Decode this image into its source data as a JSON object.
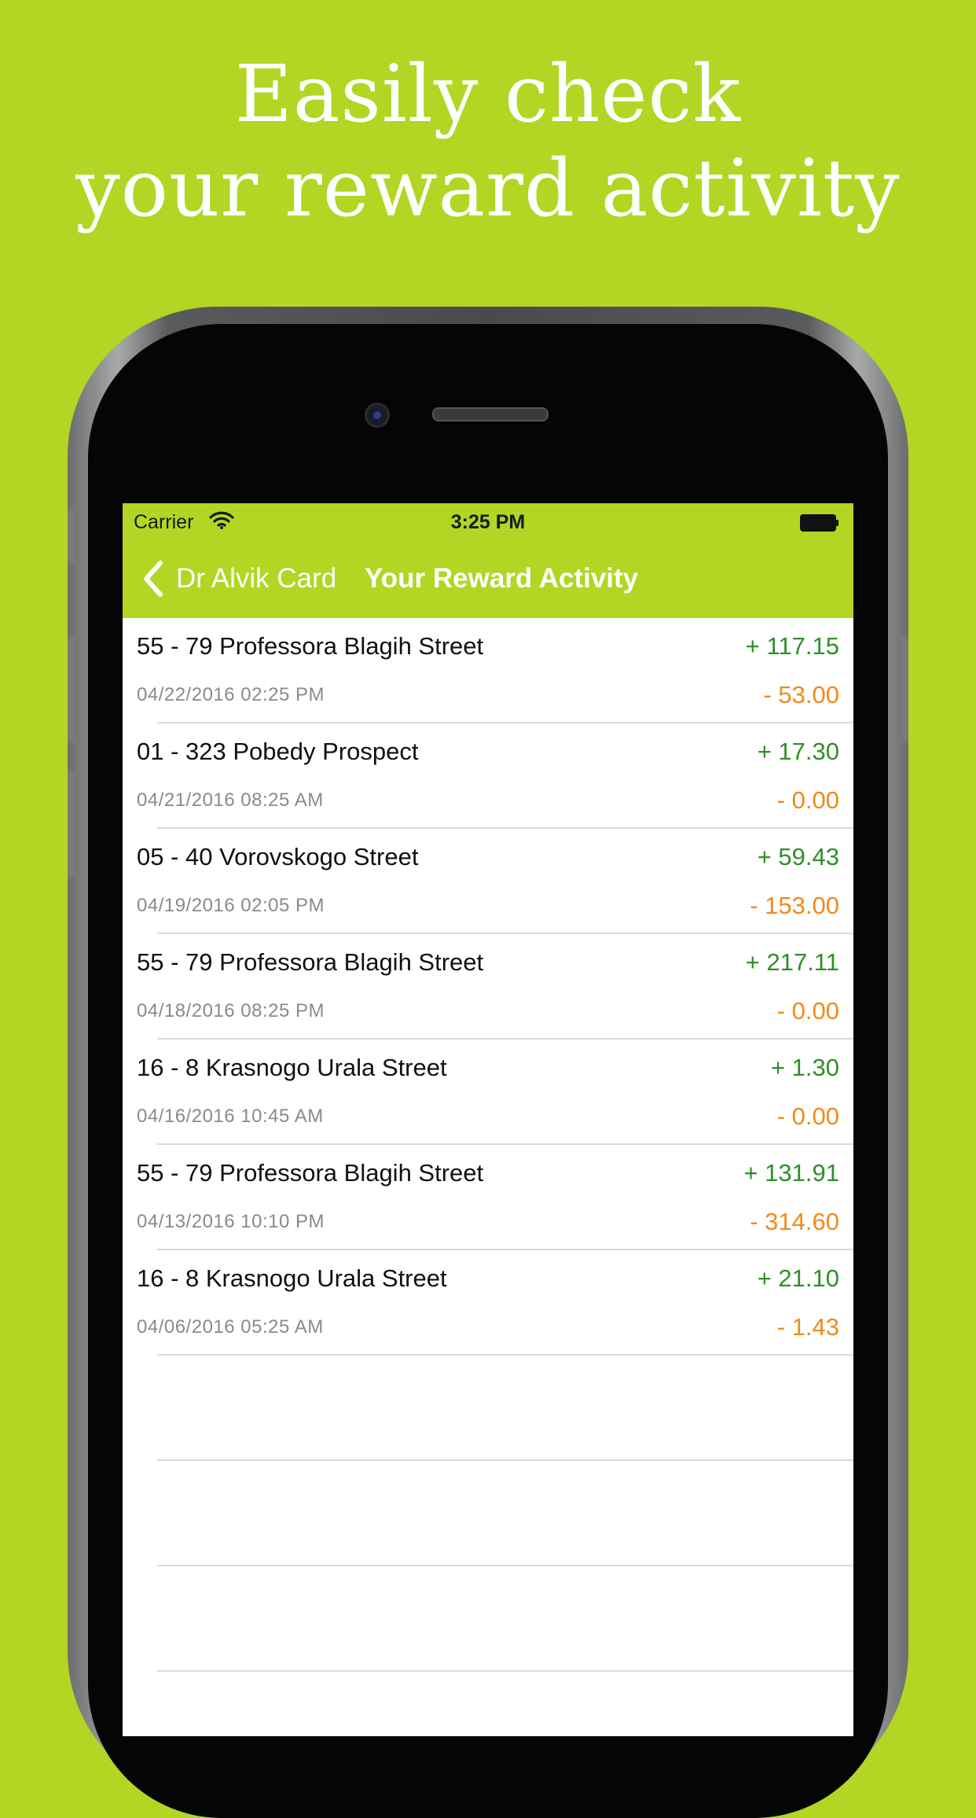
{
  "headline": {
    "line1": "Easily check",
    "line2": "your reward activity"
  },
  "status_bar": {
    "carrier": "Carrier",
    "time": "3:25 PM",
    "wifi_icon": "wifi-icon",
    "battery_icon": "battery-icon"
  },
  "nav": {
    "back_label": "Dr Alvik Card",
    "back_icon": "chevron-left-icon",
    "title": "Your Reward Activity"
  },
  "colors": {
    "brand": "#b2d623",
    "earned": "#2f8f28",
    "spent": "#f08a1c"
  },
  "activity": [
    {
      "title": "55 - 79 Professora Blagih Street",
      "date": "04/22/2016 02:25 PM",
      "plus": "+ 117.15",
      "minus": "- 53.00"
    },
    {
      "title": "01 - 323 Pobedy Prospect",
      "date": "04/21/2016 08:25 AM",
      "plus": "+ 17.30",
      "minus": "- 0.00"
    },
    {
      "title": "05 - 40 Vorovskogo Street",
      "date": "04/19/2016 02:05 PM",
      "plus": "+ 59.43",
      "minus": "- 153.00"
    },
    {
      "title": "55 - 79 Professora Blagih Street",
      "date": "04/18/2016 08:25 PM",
      "plus": "+ 217.11",
      "minus": "- 0.00"
    },
    {
      "title": "16 - 8 Krasnogo Urala Street",
      "date": "04/16/2016 10:45 AM",
      "plus": "+ 1.30",
      "minus": "- 0.00"
    },
    {
      "title": "55 - 79 Professora Blagih Street",
      "date": "04/13/2016 10:10 PM",
      "plus": "+ 131.91",
      "minus": "- 314.60"
    },
    {
      "title": "16 - 8 Krasnogo Urala Street",
      "date": "04/06/2016 05:25 AM",
      "plus": "+ 21.10",
      "minus": "- 1.43"
    }
  ]
}
